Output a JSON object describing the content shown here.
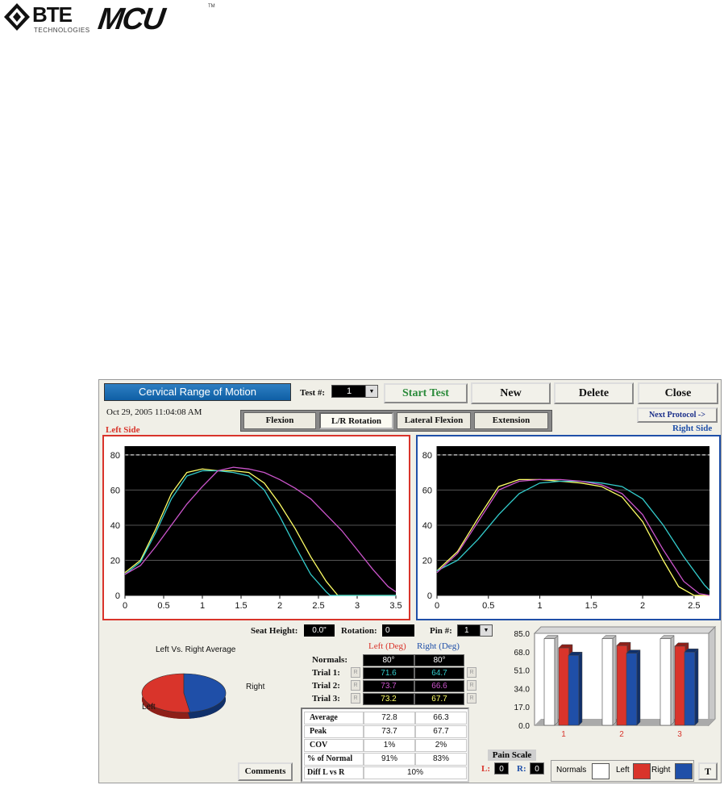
{
  "branding": {
    "bte_logo": "BTE",
    "bte_sub": "TECHNOLOGIES",
    "mcu_logo": "MCU",
    "tm": "TM"
  },
  "app": {
    "title": "Cervical Range of Motion",
    "test_label": "Test #:",
    "test_value": "1",
    "datetime": "Oct 29, 2005 11:04:08 AM",
    "buttons": {
      "start_test": "Start Test",
      "new": "New",
      "delete": "Delete",
      "close": "Close",
      "next_protocol": "Next Protocol ->",
      "comments": "Comments",
      "t": "T"
    },
    "tabs": [
      "Flexion",
      "L/R Rotation",
      "Lateral Flexion",
      "Extension"
    ],
    "active_tab": "L/R Rotation",
    "left_side_label": "Left Side",
    "right_side_label": "Right Side",
    "seat_height_label": "Seat Height:",
    "seat_height_value": "0.0\"",
    "rotation_label": "Rotation:",
    "rotation_value": "0",
    "pin_label": "Pin #:",
    "pin_value": "1",
    "pie_title": "Left Vs. Right Average",
    "pie_left": "Left",
    "pie_right": "Right",
    "col_left": "Left (Deg)",
    "col_right": "Right (Deg)",
    "r_label": "R",
    "trials": [
      {
        "label": "Normals:",
        "left": "80°",
        "right": "80°"
      },
      {
        "label": "Trial 1:",
        "left": "71.6",
        "right": "64.7"
      },
      {
        "label": "Trial 2:",
        "left": "73.7",
        "right": "66.6"
      },
      {
        "label": "Trial 3:",
        "left": "73.2",
        "right": "67.7"
      }
    ],
    "stats": [
      {
        "label": "Average",
        "left": "72.8",
        "right": "66.3"
      },
      {
        "label": "Peak",
        "left": "73.7",
        "right": "67.7"
      },
      {
        "label": "COV",
        "left": "1%",
        "right": "2%"
      },
      {
        "label": "% of Normal",
        "left": "91%",
        "right": "83%"
      },
      {
        "label": "Diff L vs R",
        "value": "10%"
      }
    ],
    "pain_scale_label": "Pain Scale",
    "pain_l_label": "L:",
    "pain_l_value": "0",
    "pain_r_label": "R:",
    "pain_r_value": "0",
    "legend": {
      "normals": "Normals",
      "left": "Left",
      "right": "Right"
    },
    "colors": {
      "left_red": "#d9342b",
      "right_blue": "#1f4fa8",
      "title_blue": "#1a6fb5",
      "trace_yellow": "#ffff66",
      "trace_cyan": "#33cccc",
      "trace_magenta": "#cc55cc"
    }
  },
  "chart_data": [
    {
      "type": "line",
      "title": "Left Side",
      "xlim": [
        0,
        3.5
      ],
      "ylim": [
        0,
        85
      ],
      "xticks": [
        "0",
        "0.5",
        "1",
        "1.5",
        "2",
        "2.5",
        "3",
        "3.5"
      ],
      "yticks": [
        "0",
        "20",
        "40",
        "60",
        "80"
      ],
      "normal_line": 80,
      "series": [
        {
          "color": "yellow",
          "x": [
            0,
            0.2,
            0.4,
            0.6,
            0.8,
            1.0,
            1.2,
            1.4,
            1.6,
            1.8,
            2.0,
            2.2,
            2.4,
            2.6,
            2.75,
            2.8,
            3.5
          ],
          "y": [
            13,
            20,
            38,
            58,
            70,
            72,
            71,
            71,
            70,
            64,
            52,
            38,
            22,
            8,
            0,
            0,
            0
          ]
        },
        {
          "color": "cyan",
          "x": [
            0,
            0.2,
            0.4,
            0.6,
            0.8,
            1.0,
            1.2,
            1.4,
            1.6,
            1.8,
            2.0,
            2.2,
            2.4,
            2.6,
            2.65,
            3.5
          ],
          "y": [
            12,
            19,
            36,
            55,
            68,
            71,
            71,
            70,
            68,
            60,
            45,
            28,
            12,
            2,
            0,
            0
          ]
        },
        {
          "color": "magenta",
          "x": [
            0,
            0.2,
            0.4,
            0.6,
            0.8,
            1.0,
            1.2,
            1.4,
            1.6,
            1.8,
            2.0,
            2.2,
            2.4,
            2.6,
            2.8,
            3.0,
            3.2,
            3.4,
            3.5
          ],
          "y": [
            12,
            17,
            28,
            40,
            52,
            62,
            71,
            73,
            72,
            70,
            66,
            61,
            55,
            46,
            37,
            26,
            15,
            5,
            2
          ]
        }
      ]
    },
    {
      "type": "line",
      "title": "Right Side",
      "xlim": [
        0,
        2.65
      ],
      "ylim": [
        0,
        85
      ],
      "xticks": [
        "0",
        "0.5",
        "1",
        "1.5",
        "2",
        "2.5"
      ],
      "yticks": [
        "0",
        "20",
        "40",
        "60",
        "80"
      ],
      "normal_line": 80,
      "series": [
        {
          "color": "yellow",
          "x": [
            0,
            0.2,
            0.4,
            0.6,
            0.8,
            1.0,
            1.2,
            1.4,
            1.6,
            1.8,
            2.0,
            2.2,
            2.35,
            2.5,
            2.65
          ],
          "y": [
            14,
            25,
            44,
            62,
            66,
            66,
            65,
            64,
            62,
            56,
            42,
            20,
            5,
            0,
            0
          ]
        },
        {
          "color": "cyan",
          "x": [
            0,
            0.2,
            0.4,
            0.6,
            0.8,
            1.0,
            1.2,
            1.4,
            1.6,
            1.8,
            2.0,
            2.2,
            2.4,
            2.6,
            2.65
          ],
          "y": [
            14,
            20,
            32,
            46,
            58,
            64,
            65,
            65,
            64,
            62,
            55,
            40,
            22,
            6,
            3
          ]
        },
        {
          "color": "magenta",
          "x": [
            0,
            0.2,
            0.4,
            0.6,
            0.8,
            1.0,
            1.2,
            1.4,
            1.6,
            1.8,
            2.0,
            2.2,
            2.4,
            2.55,
            2.65
          ],
          "y": [
            13,
            24,
            42,
            60,
            65,
            66,
            66,
            65,
            63,
            58,
            46,
            26,
            8,
            1,
            0
          ]
        }
      ]
    },
    {
      "type": "pie",
      "title": "Left Vs. Right Average",
      "categories": [
        "Left",
        "Right"
      ],
      "values": [
        72.8,
        66.3
      ]
    },
    {
      "type": "bar",
      "categories": [
        "1",
        "2",
        "3"
      ],
      "ylim": [
        0,
        85
      ],
      "yticks": [
        "0.0",
        "17.0",
        "34.0",
        "51.0",
        "68.0",
        "85.0"
      ],
      "series": [
        {
          "name": "Normals",
          "values": [
            80,
            80,
            80
          ]
        },
        {
          "name": "Left",
          "values": [
            71.6,
            73.7,
            73.2
          ]
        },
        {
          "name": "Right",
          "values": [
            64.7,
            66.6,
            67.7
          ]
        }
      ]
    }
  ]
}
